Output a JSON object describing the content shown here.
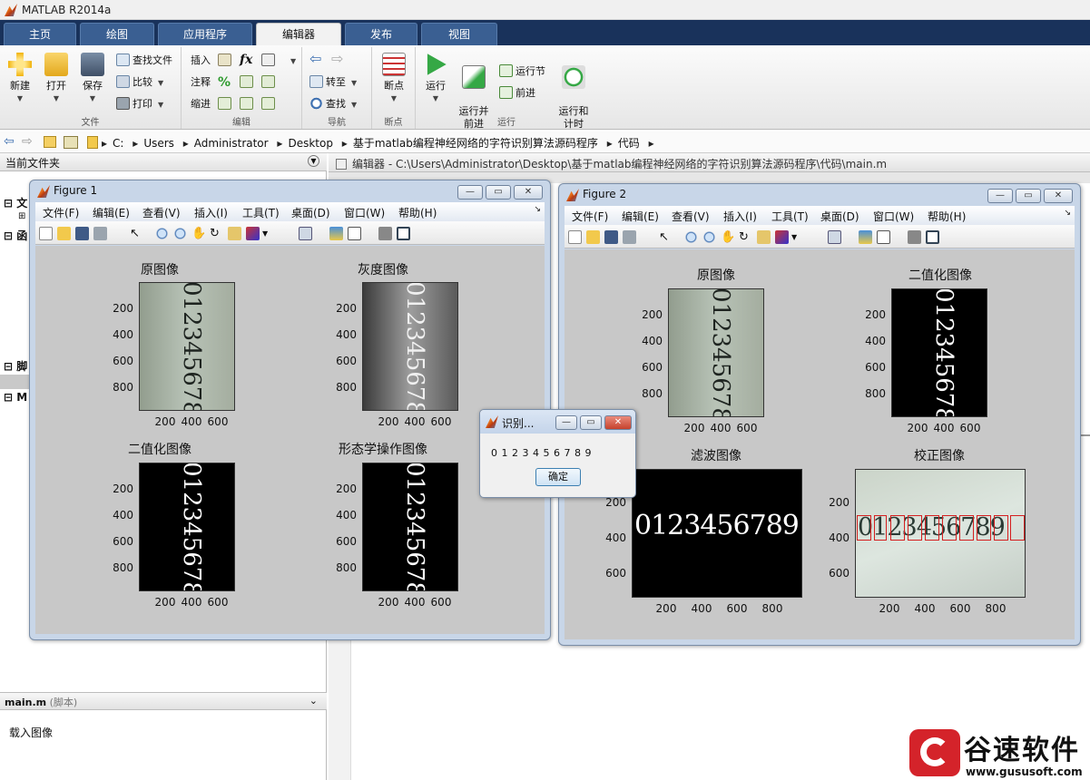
{
  "app": {
    "title": "MATLAB R2014a"
  },
  "ribbon": {
    "tabs": [
      "主页",
      "绘图",
      "应用程序",
      "编辑器",
      "发布",
      "视图"
    ],
    "active_tab": "编辑器",
    "file": {
      "title": "文件",
      "new": "新建",
      "open": "打开",
      "save": "保存",
      "find_files": "查找文件",
      "compare": "比较",
      "print": "打印"
    },
    "edit": {
      "title": "编辑",
      "insert": "插入",
      "comment": "注释",
      "indent": "缩进",
      "fx": "fx"
    },
    "navigate": {
      "title": "导航",
      "goto": "转至",
      "find": "查找"
    },
    "breakpoints": {
      "title": "断点",
      "label": "断点"
    },
    "run": {
      "title": "运行",
      "run": "运行",
      "run_advance": "运行并\n前进",
      "run_section": "运行节",
      "advance": "前进",
      "run_time": "运行和\n计时"
    }
  },
  "address": {
    "crumbs": [
      "C:",
      "Users",
      "Administrator",
      "Desktop",
      "基于matlab编程神经网络的字符识别算法源码程序",
      "代码"
    ]
  },
  "left_panel": {
    "title": "当前文件夹",
    "sections": [
      "文",
      "函",
      "脚",
      "M"
    ],
    "detail_file": "main.m",
    "detail_type": "(脚本)",
    "detail_text": "载入图像"
  },
  "editor": {
    "header": "编辑器 - C:\\Users\\Administrator\\Desktop\\基于matlab编程神经网络的字符识别算法源码程序\\代码\\main.m"
  },
  "menu_items": [
    "文件(F)",
    "编辑(E)",
    "查看(V)",
    "插入(I)",
    "工具(T)",
    "桌面(D)",
    "窗口(W)",
    "帮助(H)"
  ],
  "figure1": {
    "title": "Figure 1",
    "axes": [
      {
        "title": "原图像",
        "yticks": [
          "200",
          "400",
          "600",
          "800"
        ],
        "xticks": [
          "200",
          "400",
          "600"
        ]
      },
      {
        "title": "灰度图像",
        "yticks": [
          "200",
          "400",
          "600",
          "800"
        ],
        "xticks": [
          "200",
          "400",
          "600"
        ]
      },
      {
        "title": "二值化图像",
        "yticks": [
          "200",
          "400",
          "600",
          "800"
        ],
        "xticks": [
          "200",
          "400",
          "600"
        ]
      },
      {
        "title": "形态学操作图像",
        "yticks": [
          "200",
          "400",
          "600",
          "800"
        ],
        "xticks": [
          "200",
          "400",
          "600"
        ]
      }
    ]
  },
  "figure2": {
    "title": "Figure 2",
    "axes": [
      {
        "title": "原图像",
        "yticks": [
          "200",
          "400",
          "600",
          "800"
        ],
        "xticks": [
          "200",
          "400",
          "600"
        ]
      },
      {
        "title": "二值化图像",
        "yticks": [
          "200",
          "400",
          "600",
          "800"
        ],
        "xticks": [
          "200",
          "400",
          "600"
        ]
      },
      {
        "title": "滤波图像",
        "yticks": [
          "200",
          "400",
          "600"
        ],
        "xticks": [
          "200",
          "400",
          "600",
          "800"
        ]
      },
      {
        "title": "校正图像",
        "yticks": [
          "200",
          "400",
          "600"
        ],
        "xticks": [
          "200",
          "400",
          "600",
          "800"
        ]
      }
    ]
  },
  "image_digits": "0123456789",
  "msgbox": {
    "title": "识别...",
    "message": "0 1 2 3 4 5 6 7 8 9",
    "ok": "确定"
  },
  "watermark": {
    "brand": "谷速软件",
    "url": "www.gususoft.com"
  },
  "colors": {
    "tab_bar": "#19325b",
    "tab": "#3a5f92",
    "figure_frame": "#c8d6e8",
    "canvas": "#c8c8c8",
    "watermark_red": "#d4232a"
  }
}
